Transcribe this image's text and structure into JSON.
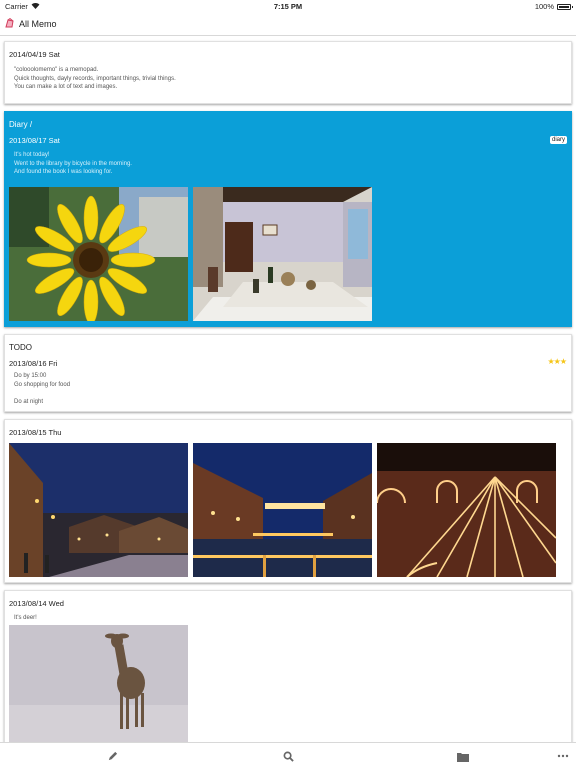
{
  "status": {
    "carrier": "Carrier",
    "time": "7:15 PM",
    "battery": "100%"
  },
  "nav": {
    "title": "All Memo",
    "icon": "memo-app-icon"
  },
  "memos": [
    {
      "date": "2014/04/19 Sat",
      "lines": [
        "\"colooolomemo\" is a memopad.",
        "Quick thoughts, dayly records, important things, trivial things.",
        "You can make a lot of text and images."
      ]
    },
    {
      "category": "Diary /",
      "date": "2013/08/17 Sat",
      "tag": "diary",
      "lines": [
        "It's hot today!",
        "Went to the library by bicycle in the morning.",
        "And found the book I was looking for."
      ],
      "photos": [
        "sunflower-photo",
        "antique-room-photo"
      ],
      "color": "#0b9fd8"
    },
    {
      "category": "TODO",
      "date": "2013/08/16 Fri",
      "stars": "★★★",
      "lines": [
        "Do by 15:00",
        "Go shopping for food",
        "",
        "Do at night"
      ]
    },
    {
      "date": "2013/08/15 Thu",
      "photos": [
        "night-street-photo",
        "canal-bridge-photo",
        "brick-lights-photo"
      ]
    },
    {
      "date": "2013/08/14 Wed",
      "lines": [
        "It's deer!"
      ],
      "photos": [
        "deer-photo"
      ]
    }
  ],
  "toolbar": {
    "items": [
      "compose-icon",
      "search-icon",
      "folder-icon",
      "more-icon"
    ]
  }
}
